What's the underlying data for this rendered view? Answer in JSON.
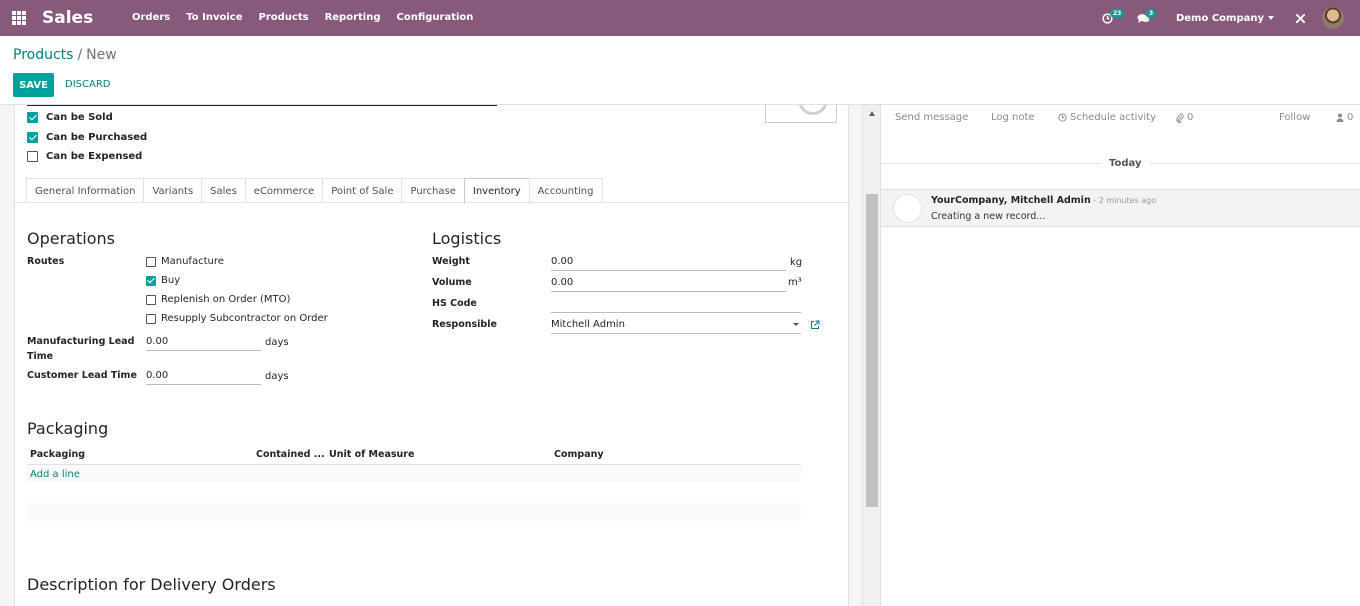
{
  "navbar": {
    "app_name": "Sales",
    "menu": [
      "Orders",
      "To Invoice",
      "Products",
      "Reporting",
      "Configuration"
    ],
    "activity_count": "23",
    "message_count": "3",
    "company": "Demo Company",
    "colors": {
      "navbar": "#875A7B",
      "accent": "#00A09D"
    }
  },
  "breadcrumb": {
    "parent": "Products",
    "separator": "/",
    "current": "New"
  },
  "buttons": {
    "save": "SAVE",
    "discard": "DISCARD"
  },
  "product_flags": [
    {
      "label": "Can be Sold",
      "checked": true
    },
    {
      "label": "Can be Purchased",
      "checked": true
    },
    {
      "label": "Can be Expensed",
      "checked": false
    }
  ],
  "tabs": [
    {
      "label": "General Information",
      "active": false
    },
    {
      "label": "Variants",
      "active": false
    },
    {
      "label": "Sales",
      "active": false
    },
    {
      "label": "eCommerce",
      "active": false
    },
    {
      "label": "Point of Sale",
      "active": false
    },
    {
      "label": "Purchase",
      "active": false
    },
    {
      "label": "Inventory",
      "active": true
    },
    {
      "label": "Accounting",
      "active": false
    }
  ],
  "operations": {
    "title": "Operations",
    "routes_label": "Routes",
    "routes": [
      {
        "label": "Manufacture",
        "checked": false
      },
      {
        "label": "Buy",
        "checked": true
      },
      {
        "label": "Replenish on Order (MTO)",
        "checked": false
      },
      {
        "label": "Resupply Subcontractor on Order",
        "checked": false
      }
    ],
    "mfg_lead_label_1": "Manufacturing Lead",
    "mfg_lead_label_2": "Time",
    "mfg_lead_value": "0.00",
    "customer_lead_label": "Customer Lead Time",
    "customer_lead_value": "0.00",
    "days_unit": "days"
  },
  "logistics": {
    "title": "Logistics",
    "weight_label": "Weight",
    "weight_value": "0.00",
    "weight_unit": "kg",
    "volume_label": "Volume",
    "volume_value": "0.00",
    "volume_unit": "m³",
    "hs_code_label": "HS Code",
    "hs_code_value": "",
    "responsible_label": "Responsible",
    "responsible_value": "Mitchell Admin"
  },
  "packaging": {
    "title": "Packaging",
    "columns": [
      "Packaging",
      "Contained ...",
      "Unit of Measure",
      "Company"
    ],
    "add_line": "Add a line"
  },
  "description_title": "Description for Delivery Orders",
  "chatter": {
    "send_message": "Send message",
    "log_note": "Log note",
    "schedule_activity": "Schedule activity",
    "attachments_count": "0",
    "follow": "Follow",
    "followers_count": "0",
    "today": "Today",
    "message": {
      "author": "YourCompany, Mitchell Admin",
      "time": " - 2 minutes ago",
      "body": "Creating a new record..."
    }
  }
}
